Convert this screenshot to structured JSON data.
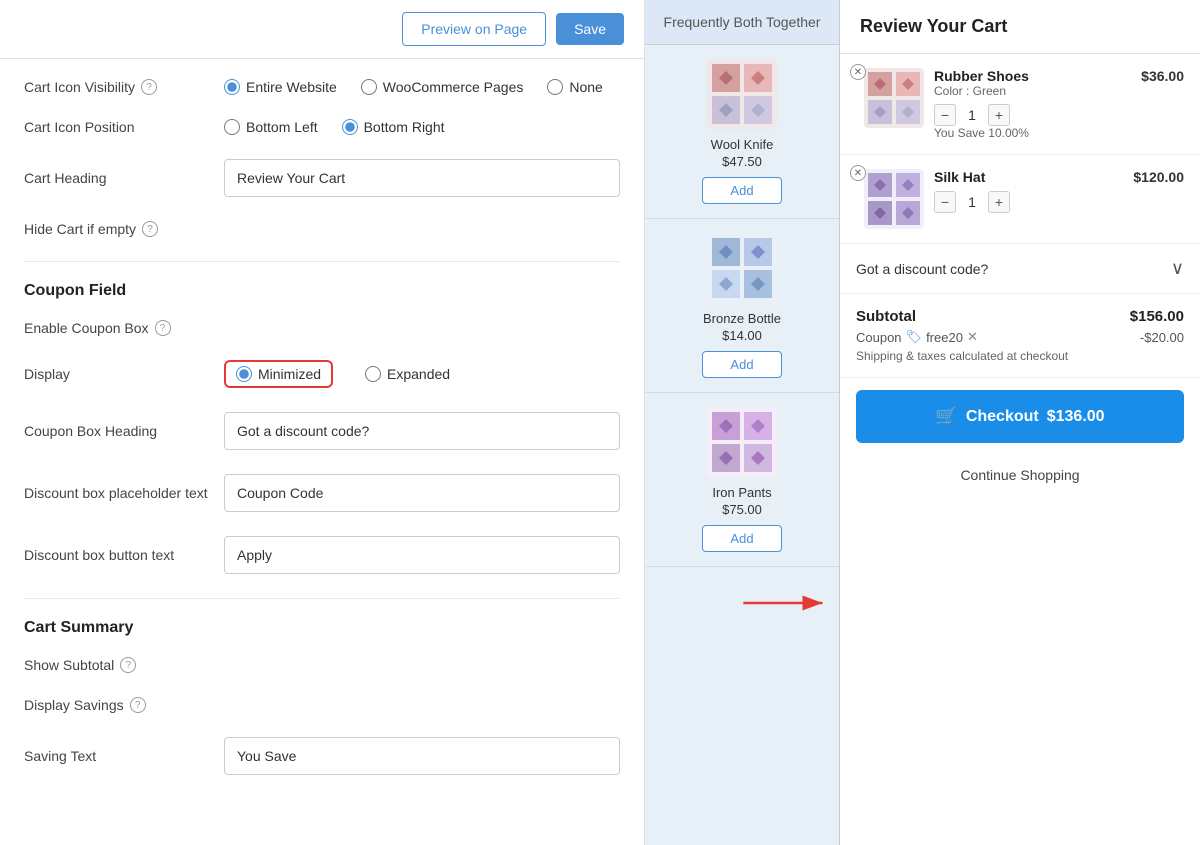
{
  "topbar": {
    "preview_label": "Preview on Page",
    "save_label": "Save"
  },
  "settings": {
    "cart_icon_visibility": {
      "label": "Cart Icon Visibility",
      "options": [
        "Entire Website",
        "WooCommerce Pages",
        "None"
      ],
      "selected": "Entire Website"
    },
    "cart_icon_position": {
      "label": "Cart Icon Position",
      "options": [
        "Bottom Left",
        "Bottom Right"
      ],
      "selected": "Bottom Right"
    },
    "cart_heading": {
      "label": "Cart Heading",
      "value": "Review Your Cart"
    },
    "hide_cart_if_empty": {
      "label": "Hide Cart if empty"
    },
    "coupon_field_section": "Coupon Field",
    "enable_coupon_box": {
      "label": "Enable Coupon Box"
    },
    "display": {
      "label": "Display",
      "options": [
        "Minimized",
        "Expanded"
      ],
      "selected": "Minimized"
    },
    "coupon_box_heading": {
      "label": "Coupon Box Heading",
      "value": "Got a discount code?"
    },
    "discount_placeholder": {
      "label": "Discount box placeholder text",
      "value": "Coupon Code"
    },
    "discount_button_text": {
      "label": "Discount box button text",
      "value": "Apply"
    },
    "cart_summary_section": "Cart Summary",
    "show_subtotal": {
      "label": "Show Subtotal"
    },
    "display_savings": {
      "label": "Display Savings"
    },
    "saving_text": {
      "label": "Saving Text",
      "value": "You Save"
    }
  },
  "middle_panel": {
    "title": "Frequently Both Together",
    "products": [
      {
        "name": "Wool Knife",
        "price": "$47.50",
        "add_label": "Add"
      },
      {
        "name": "Bronze Bottle",
        "price": "$14.00",
        "add_label": "Add"
      },
      {
        "name": "Iron Pants",
        "price": "$75.00",
        "add_label": "Add"
      }
    ]
  },
  "cart": {
    "heading": "Review Your Cart",
    "items": [
      {
        "name": "Rubber Shoes",
        "attribute": "Color : Green",
        "price": "$36.00",
        "savings": "You Save 10.00%",
        "qty": 1
      },
      {
        "name": "Silk Hat",
        "attribute": "",
        "price": "$120.00",
        "savings": "",
        "qty": 1
      }
    ],
    "coupon_text": "Got a discount code?",
    "subtotal_label": "Subtotal",
    "subtotal_value": "$156.00",
    "coupon_label": "Coupon",
    "coupon_code": "free20",
    "coupon_discount": "-$20.00",
    "shipping_note": "Shipping & taxes calculated at checkout",
    "checkout_label": "Checkout",
    "checkout_total": "$136.00",
    "continue_label": "Continue Shopping"
  },
  "colors": {
    "accent": "#4a90d9",
    "danger": "#e53935",
    "checkout_bg": "#1a8de9"
  }
}
